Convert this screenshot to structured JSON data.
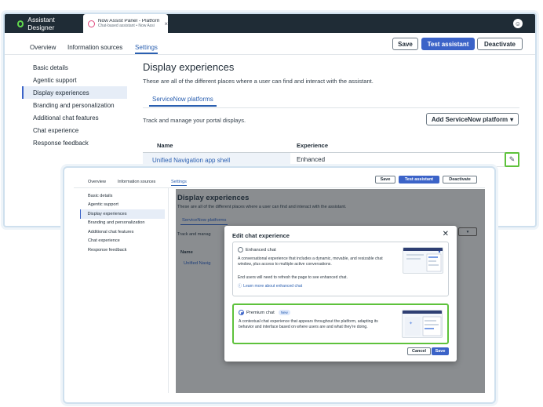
{
  "app": {
    "brand": "Assistant Designer",
    "tab_title": "Now Assist Panel - Platform",
    "tab_subtitle": "Chat-based assistant • Now Assi"
  },
  "nav_tabs": [
    "Overview",
    "Information sources",
    "Settings"
  ],
  "actions": {
    "save": "Save",
    "test": "Test assistant",
    "deactivate": "Deactivate"
  },
  "sidebar": {
    "items": [
      {
        "label": "Basic details"
      },
      {
        "label": "Agentic support"
      },
      {
        "label": "Display experiences"
      },
      {
        "label": "Branding and personalization"
      },
      {
        "label": "Additional chat features"
      },
      {
        "label": "Chat experience"
      },
      {
        "label": "Response feedback"
      }
    ],
    "selected": "Display experiences"
  },
  "main": {
    "title": "Display experiences",
    "subtitle": "These are all of the different places where a user can find and interact with the assistant.",
    "subtab": "ServiceNow platforms",
    "track_text": "Track and manage your portal displays.",
    "add_button": "Add ServiceNow platform",
    "table": {
      "headers": [
        "Name",
        "Experience"
      ],
      "rows": [
        {
          "name": "Unified Navigation app shell",
          "experience": "Enhanced"
        }
      ]
    }
  },
  "overlay": {
    "track_partial": "Track and manag",
    "unified_partial": "Unified Navig"
  },
  "modal": {
    "title": "Edit chat experience",
    "options": [
      {
        "label": "Enhanced chat",
        "description": "A conversational experience that includes a dynamic, movable, and resizable chat window, plus access to multiple active conversations.",
        "note": "End users will need to refresh the page to see enhanced chat.",
        "link": "Learn more about enhanced chat",
        "selected": false
      },
      {
        "label": "Premium chat",
        "badge": "New",
        "description": "A contextual chat experience that appears throughout the platform, adapting its behavior and interface based on where users are and what they're doing.",
        "selected": true
      }
    ],
    "cancel": "Cancel",
    "save": "Save"
  },
  "colors": {
    "appbar": "#1f2c36",
    "accent": "#3b63c8",
    "highlight": "#5ec23c",
    "overlay": "#8a8d90"
  }
}
